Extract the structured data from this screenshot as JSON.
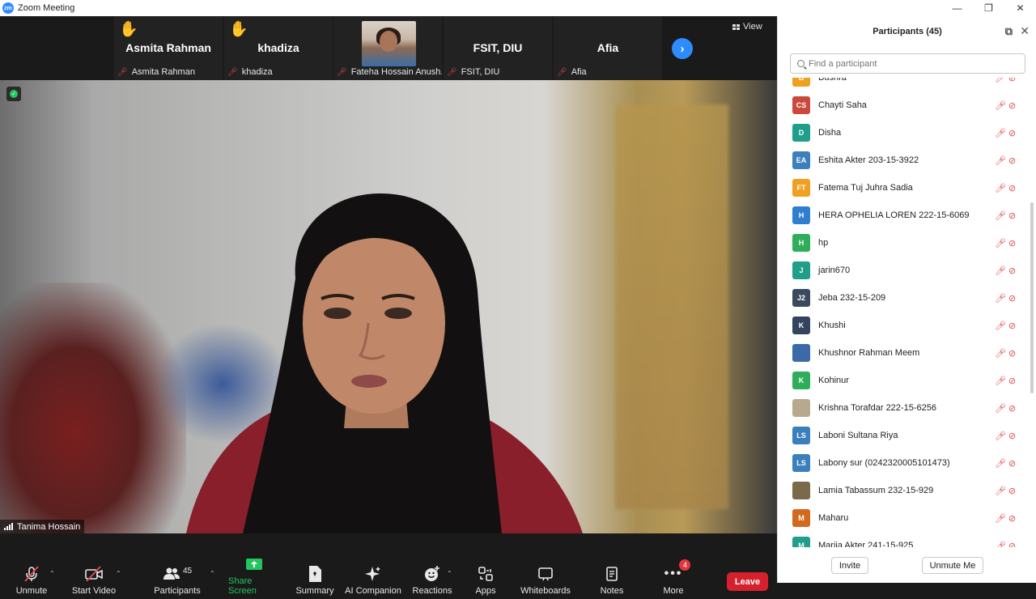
{
  "window": {
    "title": "Zoom Meeting",
    "minimize": "—",
    "maximize": "❐",
    "close": "✕"
  },
  "thumbnails": [
    {
      "big_name": "Asmita Rahman",
      "label": "Asmita Rahman",
      "hand_raised": true
    },
    {
      "big_name": "khadiza",
      "label": "khadiza",
      "hand_raised": true
    },
    {
      "big_name": "",
      "label": "Fateha Hossain Anush...",
      "hand_raised": false
    },
    {
      "big_name": "FSIT, DIU",
      "label": "FSIT, DIU",
      "hand_raised": false
    },
    {
      "big_name": "Afia",
      "label": "Afia",
      "hand_raised": false
    }
  ],
  "view_label": "View",
  "active_speaker": "Tanima Hossain",
  "toolbar": {
    "unmute": "Unmute",
    "start_video": "Start Video",
    "participants": "Participants",
    "participants_count": "45",
    "share_screen": "Share Screen",
    "summary": "Summary",
    "ai_companion": "AI Companion",
    "reactions": "Reactions",
    "apps": "Apps",
    "whiteboards": "Whiteboards",
    "notes": "Notes",
    "more": "More",
    "more_badge": "4",
    "leave": "Leave"
  },
  "panel": {
    "title": "Participants (45)",
    "search_placeholder": "Find a participant",
    "invite": "Invite",
    "unmute_me": "Unmute Me",
    "participants": [
      {
        "initials": "B",
        "name": "Bushra",
        "color": "#f0a020"
      },
      {
        "initials": "CS",
        "name": "Chayti Saha",
        "color": "#c94a3c"
      },
      {
        "initials": "D",
        "name": "Disha",
        "color": "#1f9e8a"
      },
      {
        "initials": "EA",
        "name": "Eshita Akter 203-15-3922",
        "color": "#3b7fbd"
      },
      {
        "initials": "FT",
        "name": "Fatema Tuj Juhra Sadia",
        "color": "#f0a020"
      },
      {
        "initials": "H",
        "name": "HERA OPHELIA LOREN 222-15-6069",
        "color": "#2f7fd0"
      },
      {
        "initials": "H",
        "name": "hp",
        "color": "#2eae5a"
      },
      {
        "initials": "J",
        "name": "jarin670",
        "color": "#1f9e8a"
      },
      {
        "initials": "J2",
        "name": "Jeba 232-15-209",
        "color": "#3a4a5e"
      },
      {
        "initials": "K",
        "name": "Khushi",
        "color": "#33455e"
      },
      {
        "initials": "",
        "name": "Khushnor Rahman Meem",
        "color": "#3c6aa8"
      },
      {
        "initials": "K",
        "name": "Kohinur",
        "color": "#2eae5a"
      },
      {
        "initials": "",
        "name": "Krishna Torafdar 222-15-6256",
        "color": "#b8a98e"
      },
      {
        "initials": "LS",
        "name": "Laboni Sultana Riya",
        "color": "#3b7fbd"
      },
      {
        "initials": "LS",
        "name": "Labony sur (0242320005101473)",
        "color": "#3b7fbd"
      },
      {
        "initials": "",
        "name": "Lamia Tabassum 232-15-929",
        "color": "#7a6a4a"
      },
      {
        "initials": "M",
        "name": "Maharu",
        "color": "#d2691e"
      },
      {
        "initials": "M",
        "name": "Marjia Akter 241-15-925",
        "color": "#1f9e8a"
      }
    ]
  }
}
